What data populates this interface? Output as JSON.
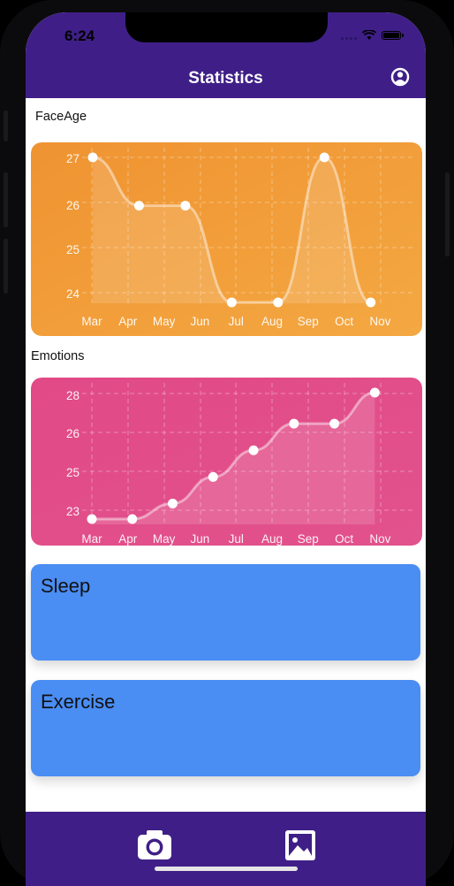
{
  "status": {
    "time": "6:24"
  },
  "nav": {
    "title": "Statistics",
    "profile_icon": "person-circle-icon"
  },
  "sections": {
    "faceage_label": "FaceAge",
    "emotions_label": "Emotions",
    "sleep_label": "Sleep",
    "exercise_label": "Exercise"
  },
  "tabbar": {
    "camera_icon": "camera-icon",
    "gallery_icon": "image-gallery-icon"
  },
  "colors": {
    "bar": "#3f1f87",
    "faceage_card": "#f19a32",
    "emotions_card": "#e04d89",
    "blue_card": "#4a8df3"
  },
  "chart_data": [
    {
      "type": "line",
      "name": "faceage",
      "categories": [
        "Mar",
        "Apr",
        "May",
        "Jun",
        "Jul",
        "Aug",
        "Sep",
        "Oct",
        "Nov"
      ],
      "yticks": [
        "27",
        "26",
        "25",
        "24"
      ],
      "x": [
        0,
        1.27,
        2.54,
        3.81,
        5.08,
        6.35,
        7.62
      ],
      "values": [
        27.1,
        26,
        26,
        23.8,
        23.8,
        27.1,
        23.8
      ],
      "ylim": [
        23.8,
        27.1
      ],
      "grid": true
    },
    {
      "type": "line",
      "name": "emotions",
      "categories": [
        "Mar",
        "Apr",
        "May",
        "Jun",
        "Jul",
        "Aug",
        "Sep",
        "Oct",
        "Nov"
      ],
      "yticks": [
        "28",
        "26",
        "25",
        "23"
      ],
      "x": [
        0,
        1.13,
        2.26,
        3.39,
        4.52,
        5.65,
        6.78,
        7.91
      ],
      "values": [
        22.5,
        22.5,
        23.2,
        24.4,
        25.6,
        26.8,
        26.8,
        28.2
      ],
      "ylim": [
        22.5,
        28.2
      ],
      "grid": true
    }
  ]
}
